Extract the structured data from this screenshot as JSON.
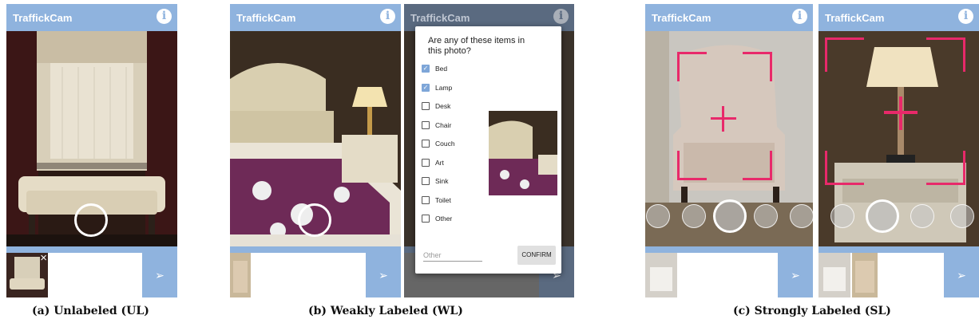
{
  "app": {
    "title": "TraffickCam",
    "info_glyph": "i",
    "send_glyph": "➢"
  },
  "dialog": {
    "question": "Are any of these items in this photo?",
    "options": [
      {
        "label": "Bed",
        "checked": true
      },
      {
        "label": "Lamp",
        "checked": true
      },
      {
        "label": "Desk",
        "checked": false
      },
      {
        "label": "Chair",
        "checked": false
      },
      {
        "label": "Couch",
        "checked": false
      },
      {
        "label": "Art",
        "checked": false
      },
      {
        "label": "Sink",
        "checked": false
      },
      {
        "label": "Toilet",
        "checked": false
      },
      {
        "label": "Other",
        "checked": false
      }
    ],
    "other_placeholder": "Other",
    "confirm_label": "CONFIRM"
  },
  "captions": {
    "ul": "(a) Unlabeled (UL)",
    "wl": "(b) Weakly Labeled (WL)",
    "sl": "(c) Strongly Labeled (SL)"
  },
  "icons": {
    "close": "×",
    "check": "✓",
    "carousel_left": [
      "lamp-icon",
      "desk-icon",
      "chair-icon",
      "couch-icon",
      "art-icon"
    ],
    "carousel_right": [
      "couch-icon",
      "lamp-icon",
      "desk-icon",
      "chair-icon"
    ]
  },
  "colors": {
    "accent": "#8fb3de",
    "target": "#e8296a",
    "dialog_check": "#7ea6d8"
  }
}
